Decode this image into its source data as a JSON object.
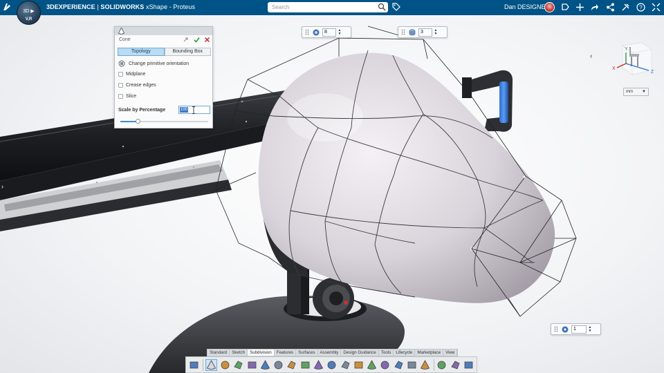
{
  "topbar": {
    "compass_label": "3D",
    "compass_version": "V,R",
    "brand": "3DEXPERIENCE",
    "separator": " | ",
    "product": "SOLIDWORKS",
    "app": " xShape - Proteus",
    "search_placeholder": "Search",
    "user_name": "Dan DESIGNER"
  },
  "cone_panel": {
    "title": "Cone",
    "tabs": [
      "Topology",
      "Bounding Box"
    ],
    "active_tab": "Topology",
    "change_orientation_label": "Change primitive orientation",
    "options": [
      "Midplane",
      "Crease edges",
      "Slice"
    ],
    "scale_label": "Scale by Percentage",
    "scale_value": "100",
    "slider_fraction": 0.2
  },
  "spinners": {
    "segments_value": "8",
    "height_segments_value": "3",
    "levels_value": "1"
  },
  "viewcube": {
    "axis_x": "X",
    "axis_y": "Y",
    "axis_z": "Z"
  },
  "unit_select": "mm",
  "bottom_tabs": [
    "Standard",
    "Sketch",
    "Subdivision",
    "Features",
    "Surfaces",
    "Assembly",
    "Design Guidance",
    "Tools",
    "Lifecycle",
    "Marketplace",
    "View"
  ],
  "active_bottom_tab": "Subdivision",
  "tool_icons": [
    "sketch-plane-icon",
    "cone-primitive-icon",
    "box-primitive-icon",
    "sphere-primitive-icon",
    "extrude-face-icon",
    "pipe-icon",
    "face-icon",
    "thicken-icon",
    "bridge-icon",
    "weld-icon",
    "mirror-icon",
    "subdivide-icon",
    "crease-icon",
    "box-cage-icon",
    "surface-icon",
    "sphere-icon",
    "sweep-icon",
    "morph-icon",
    "cube-icon",
    "plane-icon",
    "merge-icon"
  ],
  "colors": {
    "topbar": "#005386",
    "accent": "#3d8ad1",
    "active_tab": "#b8dcf3"
  }
}
